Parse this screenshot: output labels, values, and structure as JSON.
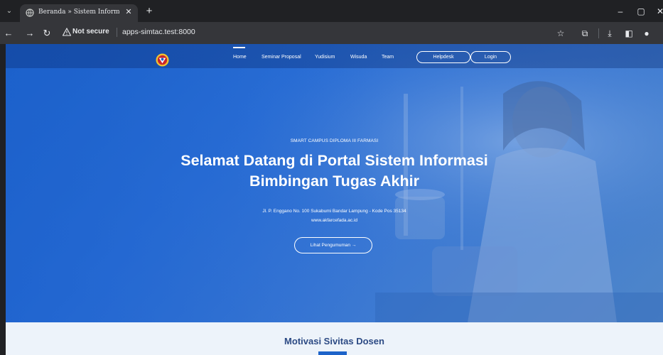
{
  "browser": {
    "tab_title": "Beranda » Sistem Informasi Bim",
    "not_secure_label": "Not secure",
    "url": "apps-simtac.test:8000"
  },
  "nav": {
    "items": [
      {
        "label": "Home",
        "active": true
      },
      {
        "label": "Seminar Proposal"
      },
      {
        "label": "Yudisium"
      },
      {
        "label": "Wisuda"
      },
      {
        "label": "Team"
      }
    ],
    "helpdesk_label": "Helpdesk",
    "login_label": "Login"
  },
  "hero": {
    "eyebrow": "SMART CAMPUS DIPLOMA III FARMASI",
    "title_line1": "Selamat Datang di Portal Sistem Informasi",
    "title_line2": "Bimbingan Tugas Akhir",
    "address": "Jl. P. Enggano No. 100 Sukabumi Bandar Lampung - Kode Pos 35134",
    "website": "www.akfarcefada.ac.id",
    "cta_label": "Lihat Pengumuman →"
  },
  "section": {
    "title": "Motivasi Sivitas Dosen"
  },
  "colors": {
    "hero_blue": "#1d63c9",
    "section_bg": "#edf3fa",
    "section_title": "#2c4a84"
  }
}
